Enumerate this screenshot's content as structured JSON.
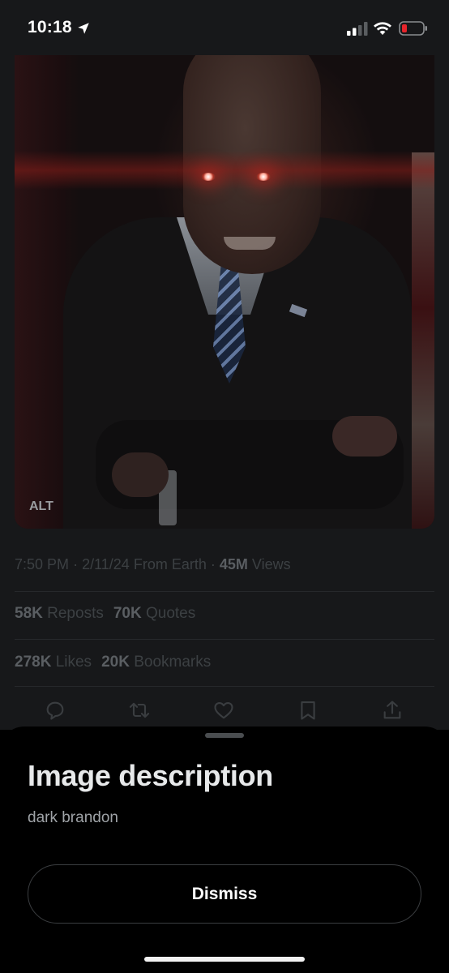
{
  "status_bar": {
    "time": "10:18",
    "icons": [
      "location-arrow-icon",
      "cellular-signal-icon",
      "wifi-icon",
      "battery-low-icon"
    ],
    "battery_color": "#e5242b"
  },
  "tweet": {
    "media": {
      "alt_badge": "ALT"
    },
    "meta": {
      "time": "7:50 PM",
      "separator": "·",
      "date": "2/11/24",
      "source": "From Earth",
      "views_count": "45M",
      "views_label": "Views"
    },
    "stats": {
      "reposts_count": "58K",
      "reposts_label": "Reposts",
      "quotes_count": "70K",
      "quotes_label": "Quotes",
      "likes_count": "278K",
      "likes_label": "Likes",
      "bookmarks_count": "20K",
      "bookmarks_label": "Bookmarks"
    },
    "actions": [
      "reply-icon",
      "retweet-icon",
      "like-icon",
      "bookmark-icon",
      "share-icon"
    ]
  },
  "sheet": {
    "title": "Image description",
    "description": "dark brandon",
    "dismiss_label": "Dismiss"
  },
  "colors": {
    "background": "#000000",
    "dimmed": "#17181a",
    "text_primary": "#e7e9ea",
    "text_secondary": "#9fa3a7"
  }
}
